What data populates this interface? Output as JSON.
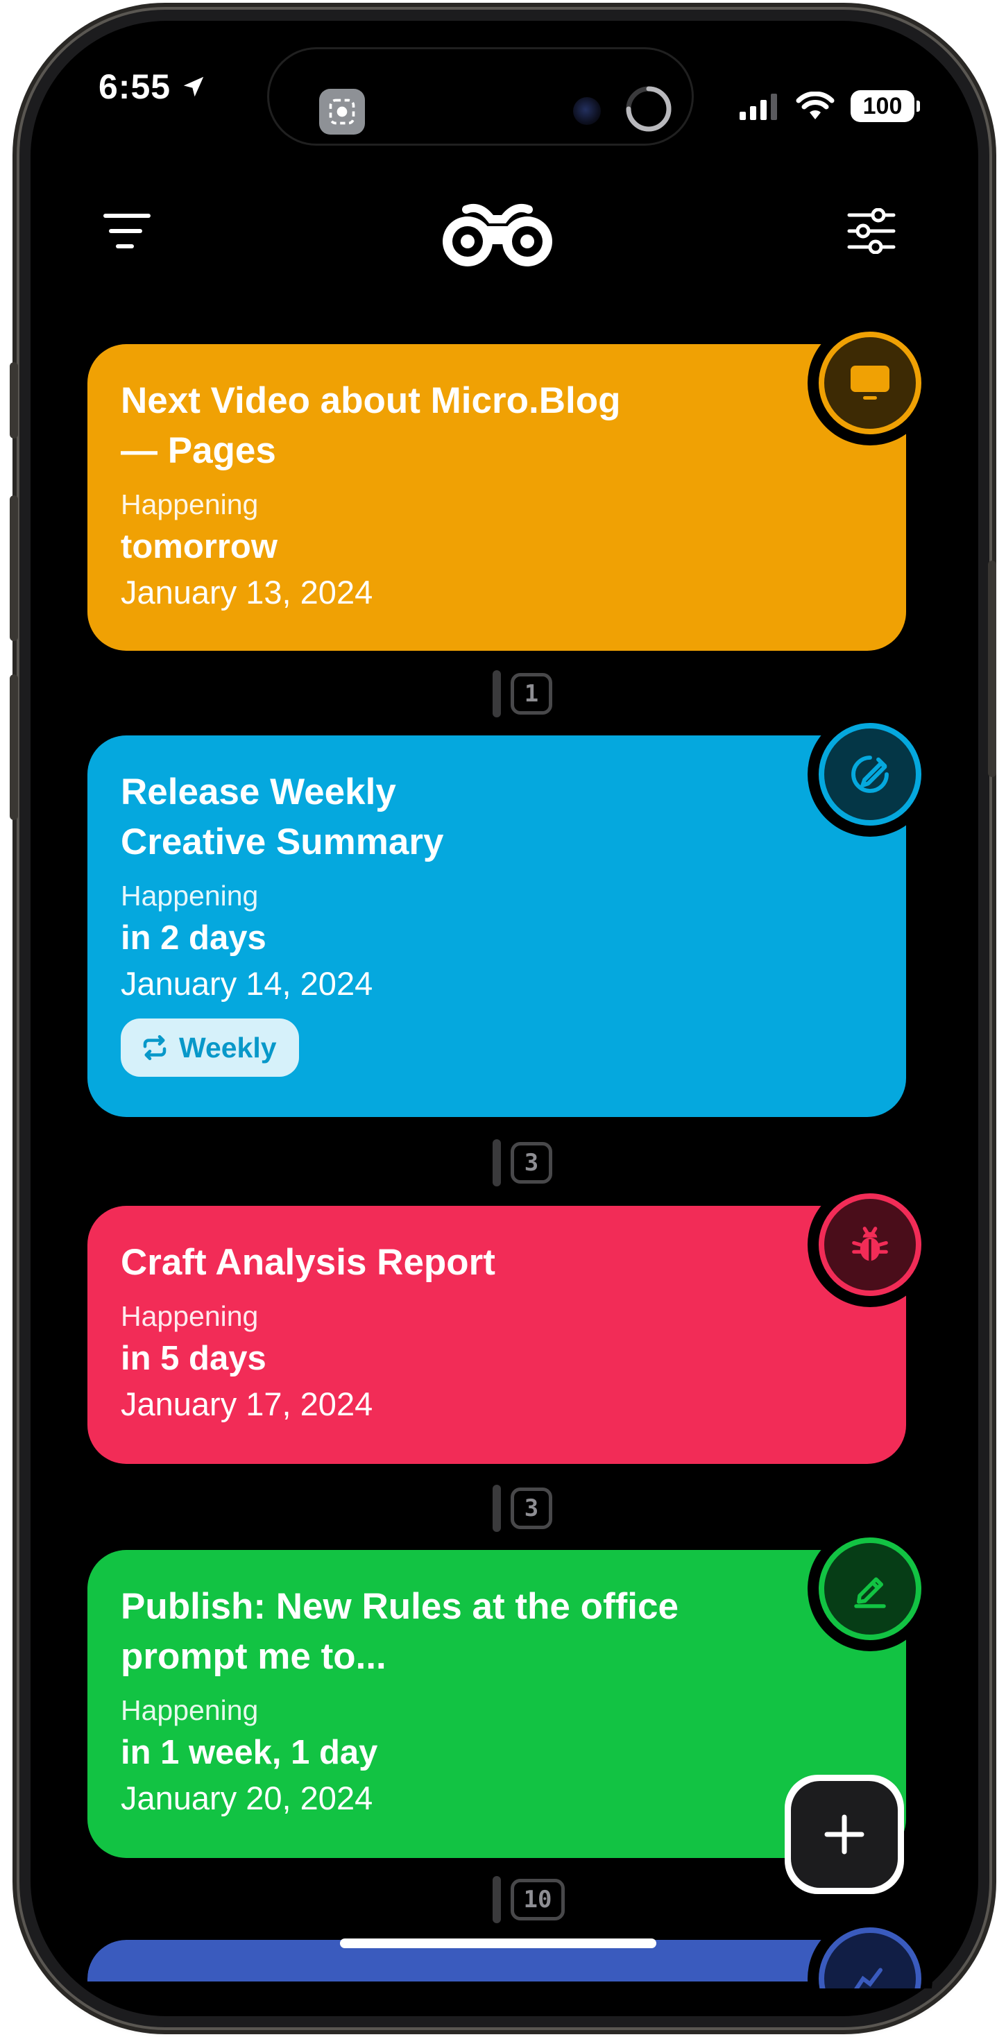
{
  "status_bar": {
    "time": "6:55",
    "battery": "100",
    "location_icon": "location-arrow-icon",
    "signal_icon": "cellular-signal-icon",
    "wifi_icon": "wifi-icon"
  },
  "header": {
    "left_icon": "filter-lines-icon",
    "logo_icon": "binoculars-logo-icon",
    "right_icon": "sliders-icon"
  },
  "cards": [
    {
      "title_line1": "Next Video about Micro.Blog",
      "title_line2": "— Pages",
      "label": "Happening",
      "relative": "tomorrow",
      "date": "January 13, 2024",
      "color": "#F0A104",
      "icon": "tv-icon"
    },
    {
      "title_line1": "Release Weekly",
      "title_line2": "Creative Summary",
      "label": "Happening",
      "relative": "in 2 days",
      "date": "January 14, 2024",
      "badge": "Weekly",
      "color": "#05A8DE",
      "icon": "compass-pencil-icon"
    },
    {
      "title_line1": "Craft Analysis Report",
      "label": "Happening",
      "relative": "in 5 days",
      "date": "January 17, 2024",
      "color": "#F22C57",
      "icon": "bug-icon"
    },
    {
      "title_line1": "Publish: New Rules at the office",
      "title_line2": "prompt me to...",
      "label": "Happening",
      "relative": "in 1 week, 1 day",
      "date": "January 20, 2024",
      "color": "#12C343",
      "icon": "pencil-line-icon"
    },
    {
      "color": "#3A5BBE",
      "icon": "partial-icon"
    }
  ],
  "connectors": [
    "1",
    "3",
    "3",
    "10"
  ],
  "fab": {
    "icon": "plus-icon"
  }
}
